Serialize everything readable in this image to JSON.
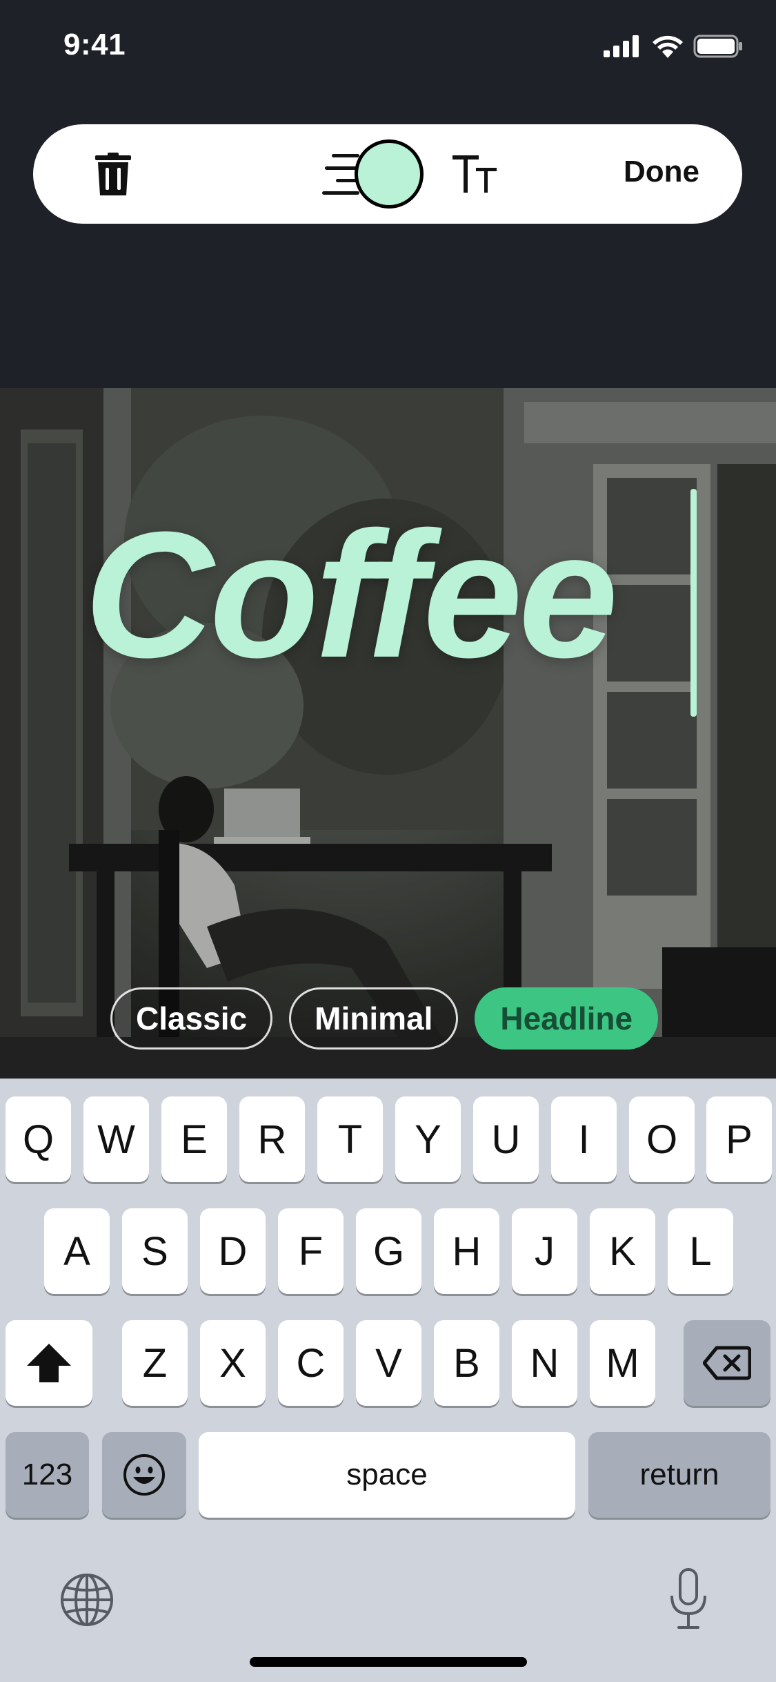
{
  "status_bar": {
    "time": "9:41"
  },
  "toolbar": {
    "done_label": "Done",
    "selected_color": "#b9f2d6",
    "icons": [
      "trash-icon",
      "text-align-icon",
      "color-swatch",
      "text-size-icon"
    ]
  },
  "editor": {
    "text": "Coffee",
    "text_color": "#b9f2d6",
    "styles": [
      {
        "label": "Classic",
        "active": false
      },
      {
        "label": "Minimal",
        "active": false
      },
      {
        "label": "Headline",
        "active": true
      }
    ]
  },
  "keyboard": {
    "row1": [
      "Q",
      "W",
      "E",
      "R",
      "T",
      "Y",
      "U",
      "I",
      "O",
      "P"
    ],
    "row2": [
      "A",
      "S",
      "D",
      "F",
      "G",
      "H",
      "J",
      "K",
      "L"
    ],
    "row3": [
      "Z",
      "X",
      "C",
      "V",
      "B",
      "N",
      "M"
    ],
    "numbers_label": "123",
    "space_label": "space",
    "return_label": "return",
    "icons": [
      "shift-icon",
      "backspace-icon",
      "emoji-icon",
      "globe-icon",
      "microphone-icon"
    ]
  },
  "colors": {
    "accent_green": "#3dc583",
    "background": "#1e2127",
    "keyboard_bg": "#cfd3db"
  }
}
